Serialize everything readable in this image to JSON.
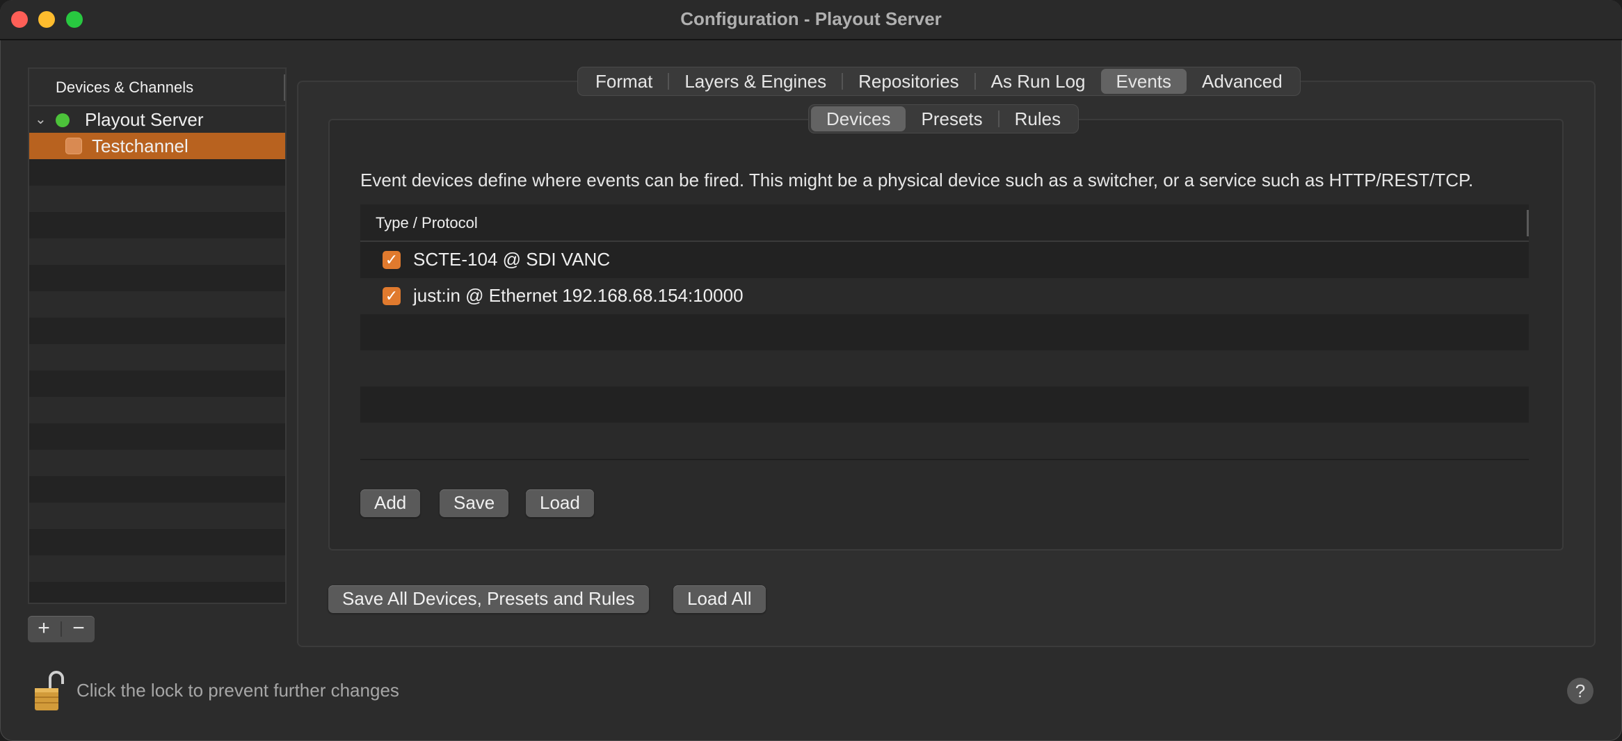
{
  "window": {
    "title": "Configuration - Playout Server"
  },
  "sidebar": {
    "header": "Devices & Channels",
    "items": [
      {
        "label": "Playout Server",
        "status_color": "#4cc23a",
        "expanded": true
      },
      {
        "label": "Testchannel",
        "selected": true
      }
    ],
    "add_label": "+",
    "remove_label": "−"
  },
  "tabs": {
    "items": [
      {
        "label": "Format"
      },
      {
        "label": "Layers & Engines"
      },
      {
        "label": "Repositories"
      },
      {
        "label": "As Run Log"
      },
      {
        "label": "Events",
        "active": true
      },
      {
        "label": "Advanced"
      }
    ]
  },
  "subtabs": {
    "items": [
      {
        "label": "Devices",
        "active": true
      },
      {
        "label": "Presets"
      },
      {
        "label": "Rules"
      }
    ]
  },
  "devices": {
    "description": "Event devices define where events can be fired. This might be a physical device such as a switcher, or a service such as HTTP/REST/TCP.",
    "column_header": "Type / Protocol",
    "rows": [
      {
        "label": "SCTE-104 @ SDI VANC",
        "checked": true
      },
      {
        "label": "just:in @ Ethernet 192.168.68.154:10000",
        "checked": true
      }
    ],
    "buttons": {
      "add": "Add",
      "save": "Save",
      "load": "Load"
    }
  },
  "footer_buttons": {
    "save_all": "Save All Devices, Presets and Rules",
    "load_all": "Load All"
  },
  "lock": {
    "text": "Click the lock to prevent further changes",
    "locked": false
  },
  "help_label": "?",
  "colors": {
    "accent": "#e07a2e",
    "selection": "#b8621f"
  }
}
